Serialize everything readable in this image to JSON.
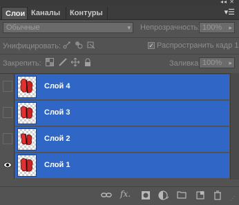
{
  "tabs": [
    "Слои",
    "Каналы",
    "Контуры"
  ],
  "blend_mode": "Обычные",
  "opacity": {
    "label": "Непрозрачность:",
    "value": "100%"
  },
  "unify": {
    "label": "Унифицировать:"
  },
  "propagate": {
    "label": "Распространить кадр 1",
    "checked": true
  },
  "lock": {
    "label": "Закрепить:"
  },
  "fill": {
    "label": "Заливка:",
    "value": "100%"
  },
  "layers": [
    {
      "name": "Слой 4",
      "visible": false,
      "selected": true
    },
    {
      "name": "Слой 3",
      "visible": false,
      "selected": true
    },
    {
      "name": "Слой 2",
      "visible": false,
      "selected": true
    },
    {
      "name": "Слой 1",
      "visible": true,
      "selected": true
    }
  ],
  "bottom_icons": [
    "link-layers-icon",
    "fx-icon",
    "add-mask-icon",
    "adjustment-layer-icon",
    "new-group-icon",
    "new-layer-icon",
    "trash-icon"
  ],
  "colors": {
    "selection": "#3067c6",
    "panel": "#535353"
  }
}
